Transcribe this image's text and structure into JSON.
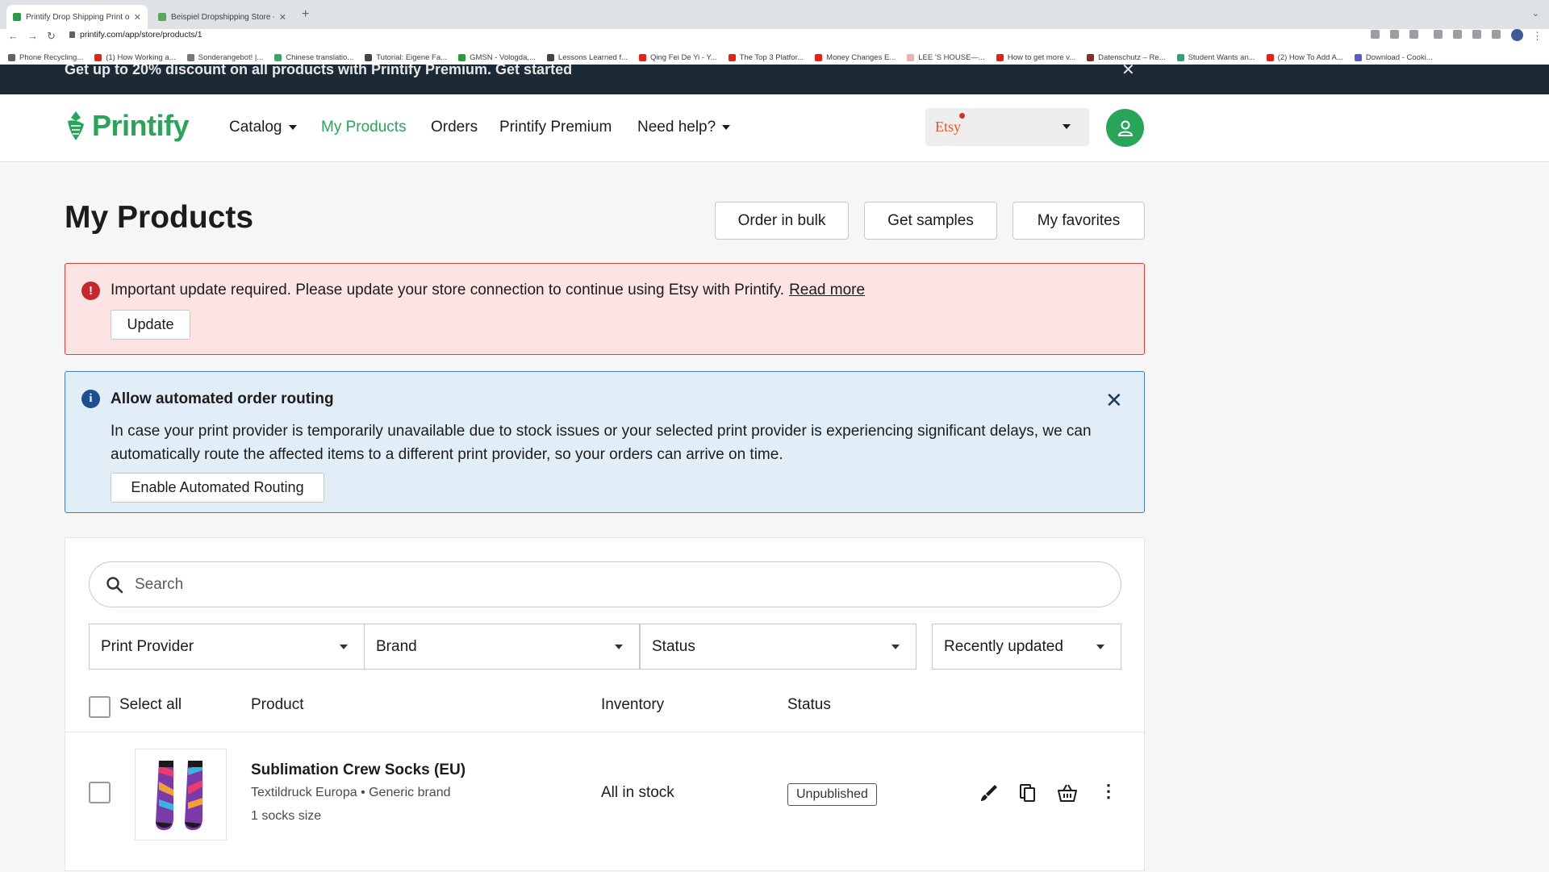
{
  "browser": {
    "tabs": [
      {
        "title": "Printify Drop Shipping Print on",
        "active": true
      },
      {
        "title": "Beispiel Dropshipping Store - ",
        "active": false
      }
    ],
    "new_tab_label": "+",
    "url": "printify.com/app/store/products/1",
    "bookmarks": [
      {
        "label": "Phone Recycling...",
        "icon": "globe-icon",
        "color": "#5f6368"
      },
      {
        "label": "(1) How Working a...",
        "icon": "youtube-icon",
        "color": "#e62117"
      },
      {
        "label": "Sonderangebot! |...",
        "icon": "bookmark-icon",
        "color": "#777777"
      },
      {
        "label": "Chinese translatio...",
        "icon": "bookmark-icon",
        "color": "#3aa564"
      },
      {
        "label": "Tutorial: Eigene Fa...",
        "icon": "hash-icon",
        "color": "#444444"
      },
      {
        "label": "GMSN - Vologda,...",
        "icon": "bookmark-icon",
        "color": "#2a9a3a"
      },
      {
        "label": "Lessons Learned f...",
        "icon": "bookmark-icon",
        "color": "#444444"
      },
      {
        "label": "Qing Fei De Yi - Y...",
        "icon": "youtube-icon",
        "color": "#e62117"
      },
      {
        "label": "The Top 3 Platfor...",
        "icon": "youtube-icon",
        "color": "#e62117"
      },
      {
        "label": "Money Changes E...",
        "icon": "youtube-icon",
        "color": "#e62117"
      },
      {
        "label": "LEE 'S HOUSE—...",
        "icon": "bookmark-icon",
        "color": "#e5b3b3"
      },
      {
        "label": "How to get more v...",
        "icon": "youtube-icon",
        "color": "#e62117"
      },
      {
        "label": "Datenschutz – Re...",
        "icon": "bookmark-icon",
        "color": "#8a2a2a"
      },
      {
        "label": "Student Wants an...",
        "icon": "bookmark-icon",
        "color": "#2aa57a"
      },
      {
        "label": "(2) How To Add A...",
        "icon": "youtube-icon",
        "color": "#e62117"
      },
      {
        "label": "Download - Cooki...",
        "icon": "bookmark-icon",
        "color": "#5a5ad0"
      }
    ]
  },
  "promo": {
    "text": "Get up to 20% discount on all products with Printify Premium. Get started"
  },
  "header": {
    "logo": "Printify",
    "nav": [
      {
        "label": "Catalog",
        "has_caret": true,
        "active": false
      },
      {
        "label": "My Products",
        "has_caret": false,
        "active": true
      },
      {
        "label": "Orders",
        "has_caret": false,
        "active": false
      },
      {
        "label": "Printify Premium",
        "has_caret": false,
        "active": false
      },
      {
        "label": "Need help?",
        "has_caret": true,
        "active": false
      }
    ],
    "store_selector": "Etsy",
    "brand_color": "#29a55a"
  },
  "page": {
    "title": "My Products",
    "buttons": {
      "bulk": "Order in bulk",
      "samples": "Get samples",
      "favorites": "My favorites"
    }
  },
  "alert_error": {
    "message": "Important update required. Please update your store connection to continue using Etsy with Printify.",
    "link": "Read more",
    "button": "Update",
    "icon": "exclamation-icon",
    "color": "#c4282d"
  },
  "alert_info": {
    "title": "Allow automated order routing",
    "body": "In case your print provider is temporarily unavailable due to stock issues or your selected print provider is experiencing significant delays, we can automatically route the affected items to a different print provider, so your orders can arrive on time.",
    "button": "Enable Automated Routing",
    "icon": "info-icon",
    "color": "#1d4f91"
  },
  "products": {
    "search_placeholder": "Search",
    "filters": {
      "provider": "Print Provider",
      "brand": "Brand",
      "status": "Status",
      "sort": "Recently updated"
    },
    "columns": {
      "select_all": "Select all",
      "product": "Product",
      "inventory": "Inventory",
      "status": "Status"
    },
    "rows": [
      {
        "name": "Sublimation Crew Socks (EU)",
        "subtitle": "Textildruck Europa • Generic brand",
        "size": "1 socks size",
        "inventory": "All in stock",
        "status": "Unpublished"
      }
    ]
  }
}
